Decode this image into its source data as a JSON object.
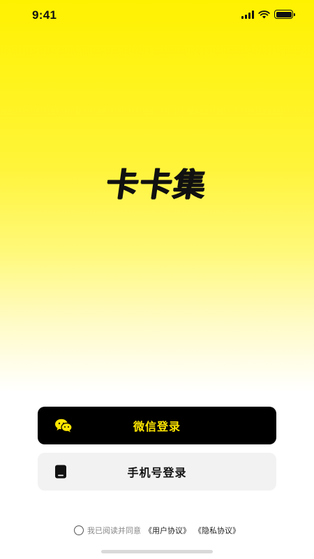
{
  "status_bar": {
    "time": "9:41"
  },
  "app": {
    "logo_text": "卡卡集"
  },
  "login": {
    "wechat_label": "微信登录",
    "phone_label": "手机号登录"
  },
  "agreement": {
    "prefix": "我已阅读并同意",
    "user_agreement": "《用户协议》",
    "privacy_policy": "《隐私协议》"
  },
  "colors": {
    "brand_yellow": "#fff200",
    "wechat_label_color": "#ffe600",
    "wechat_button_bg": "#000000",
    "phone_button_bg": "#f2f2f2"
  }
}
